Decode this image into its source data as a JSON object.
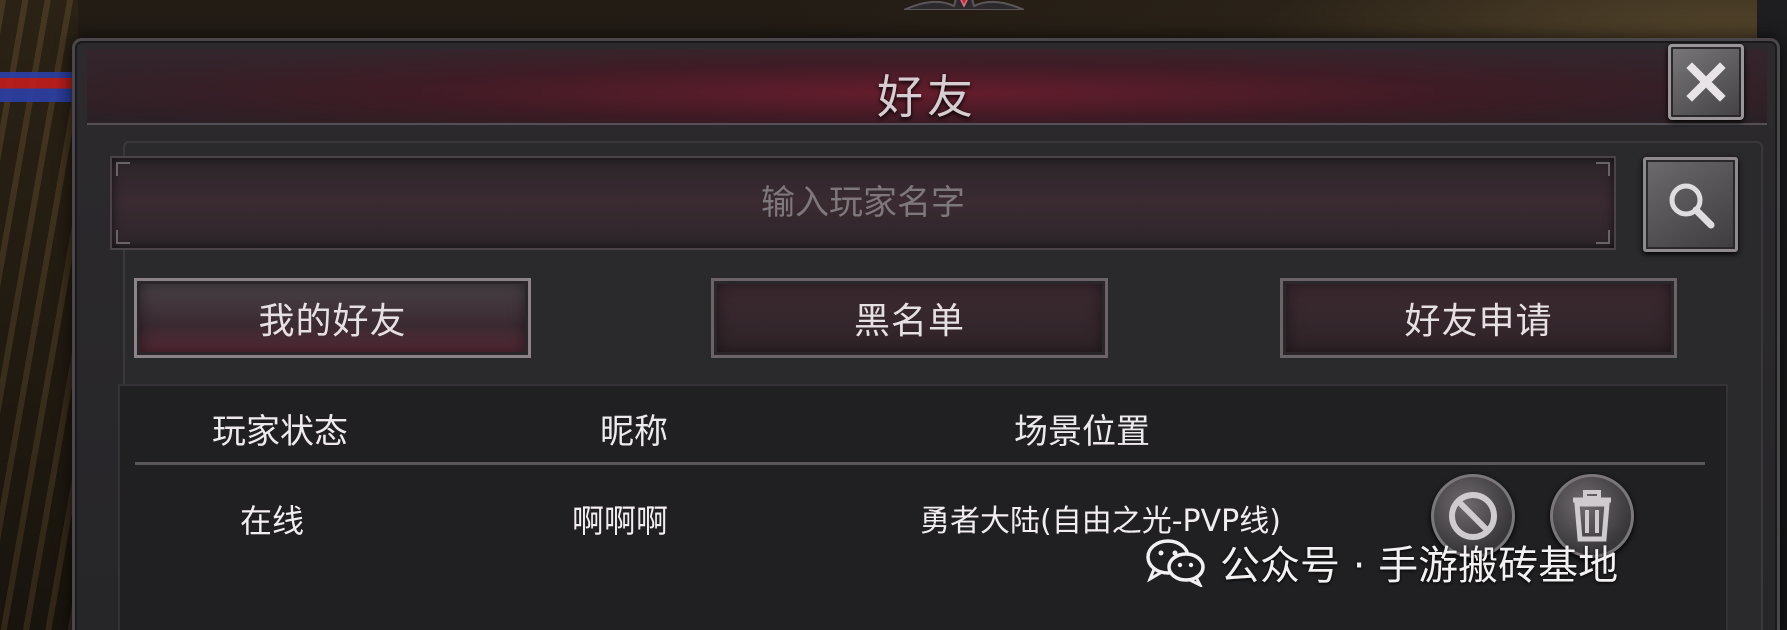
{
  "window": {
    "title": "好友",
    "close_icon": "close-icon"
  },
  "search": {
    "placeholder": "输入玩家名字",
    "value": "",
    "button_icon": "search-icon"
  },
  "tabs": [
    {
      "label": "我的好友",
      "active": true
    },
    {
      "label": "黑名单",
      "active": false
    },
    {
      "label": "好友申请",
      "active": false
    }
  ],
  "table": {
    "headers": [
      "玩家状态",
      "昵称",
      "场景位置"
    ],
    "rows": [
      {
        "status": "在线",
        "nickname": "啊啊啊",
        "location": "勇者大陆(自由之光-PVP线)",
        "actions": [
          "block-icon",
          "trash-icon"
        ]
      }
    ]
  },
  "watermark": {
    "icon": "wechat-icon",
    "text": "公众号 · 手游搬砖基地"
  },
  "colors": {
    "panel_bg": "#2a292c",
    "title_accent": "#78192d",
    "text": "#eeeaec",
    "placeholder": "#7e777b"
  }
}
